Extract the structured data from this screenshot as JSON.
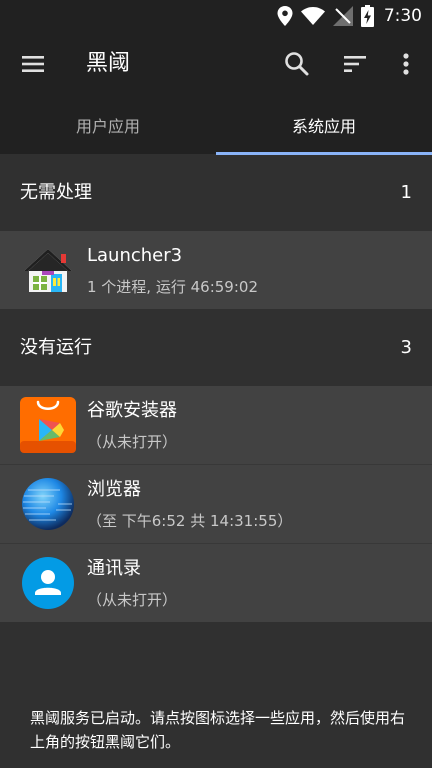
{
  "status_bar": {
    "time": "7:30",
    "icons": [
      "location-icon",
      "wifi-icon",
      "no-signal-icon",
      "battery-charging-icon"
    ]
  },
  "toolbar": {
    "title": "黑阈",
    "icons": [
      "menu-icon",
      "search-icon",
      "sort-icon",
      "more-vert-icon"
    ]
  },
  "tabs": [
    {
      "label": "用户应用",
      "selected": false
    },
    {
      "label": "系统应用",
      "selected": true
    }
  ],
  "accent_color": "#8ab4f8",
  "sections": [
    {
      "title": "无需处理",
      "count": "1",
      "apps": [
        {
          "name": "Launcher3",
          "subtitle": "1 个进程, 运行 46:59:02",
          "icon": "launcher3-icon"
        }
      ]
    },
    {
      "title": "没有运行",
      "count": "3",
      "apps": [
        {
          "name": "谷歌安装器",
          "subtitle": "（从未打开）",
          "icon": "google-installer-icon"
        },
        {
          "name": "浏览器",
          "subtitle": "（至 下午6:52 共 14:31:55）",
          "icon": "browser-globe-icon"
        },
        {
          "name": "通讯录",
          "subtitle": "（从未打开）",
          "icon": "contacts-icon"
        }
      ]
    }
  ],
  "footer": {
    "message": "黑阈服务已启动。请点按图标选择一些应用，然后使用右上角的按钮黑阈它们。"
  }
}
